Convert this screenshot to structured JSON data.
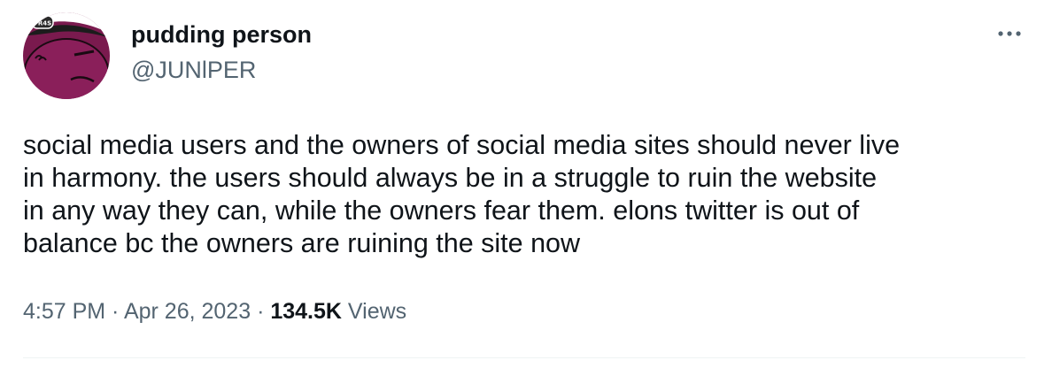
{
  "author": {
    "display_name": "pudding person",
    "handle": "@JUNlPER",
    "avatar_badge_text": "PR4S"
  },
  "tweet": {
    "text": "social media users and the owners of social media sites should never live\nin harmony.  the users should always be in a struggle to ruin the website\nin any way they can, while the owners fear them.  elons twitter is out of\nbalance bc the owners are ruining the site now"
  },
  "meta": {
    "time": "4:57 PM",
    "separator": " · ",
    "date": "Apr 26, 2023",
    "views_count": "134.5K",
    "views_label": " Views"
  },
  "icons": {
    "more": "more-horizontal-icon"
  },
  "colors": {
    "primary_text": "#0f1419",
    "secondary_text": "#536471",
    "avatar_background": "#7a1a4e"
  }
}
